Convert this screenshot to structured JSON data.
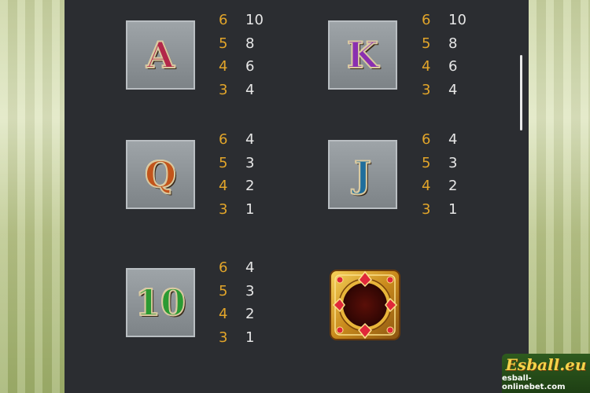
{
  "symbols": [
    {
      "label": "A",
      "color": "#b2284a",
      "payouts": [
        {
          "count": "6",
          "value": "10"
        },
        {
          "count": "5",
          "value": "8"
        },
        {
          "count": "4",
          "value": "6"
        },
        {
          "count": "3",
          "value": "4"
        }
      ]
    },
    {
      "label": "K",
      "color": "#8a2fb0",
      "payouts": [
        {
          "count": "6",
          "value": "10"
        },
        {
          "count": "5",
          "value": "8"
        },
        {
          "count": "4",
          "value": "6"
        },
        {
          "count": "3",
          "value": "4"
        }
      ]
    },
    {
      "label": "Q",
      "color": "#c2541a",
      "payouts": [
        {
          "count": "6",
          "value": "4"
        },
        {
          "count": "5",
          "value": "3"
        },
        {
          "count": "4",
          "value": "2"
        },
        {
          "count": "3",
          "value": "1"
        }
      ]
    },
    {
      "label": "J",
      "color": "#1f6e9c",
      "payouts": [
        {
          "count": "6",
          "value": "4"
        },
        {
          "count": "5",
          "value": "3"
        },
        {
          "count": "4",
          "value": "2"
        },
        {
          "count": "3",
          "value": "1"
        }
      ]
    },
    {
      "label": "10",
      "color": "#2a9a32",
      "payouts": [
        {
          "count": "6",
          "value": "4"
        },
        {
          "count": "5",
          "value": "3"
        },
        {
          "count": "4",
          "value": "2"
        },
        {
          "count": "3",
          "value": "1"
        }
      ]
    }
  ],
  "special_symbol": {
    "icon": "golden-jeweled-frame-icon"
  },
  "watermark": {
    "logo": "Esball.eu",
    "url": "esball-onlinebet.com"
  },
  "colors": {
    "background": "#2b2d31",
    "count": "#e2a52a",
    "payout": "#e6e6e6"
  }
}
